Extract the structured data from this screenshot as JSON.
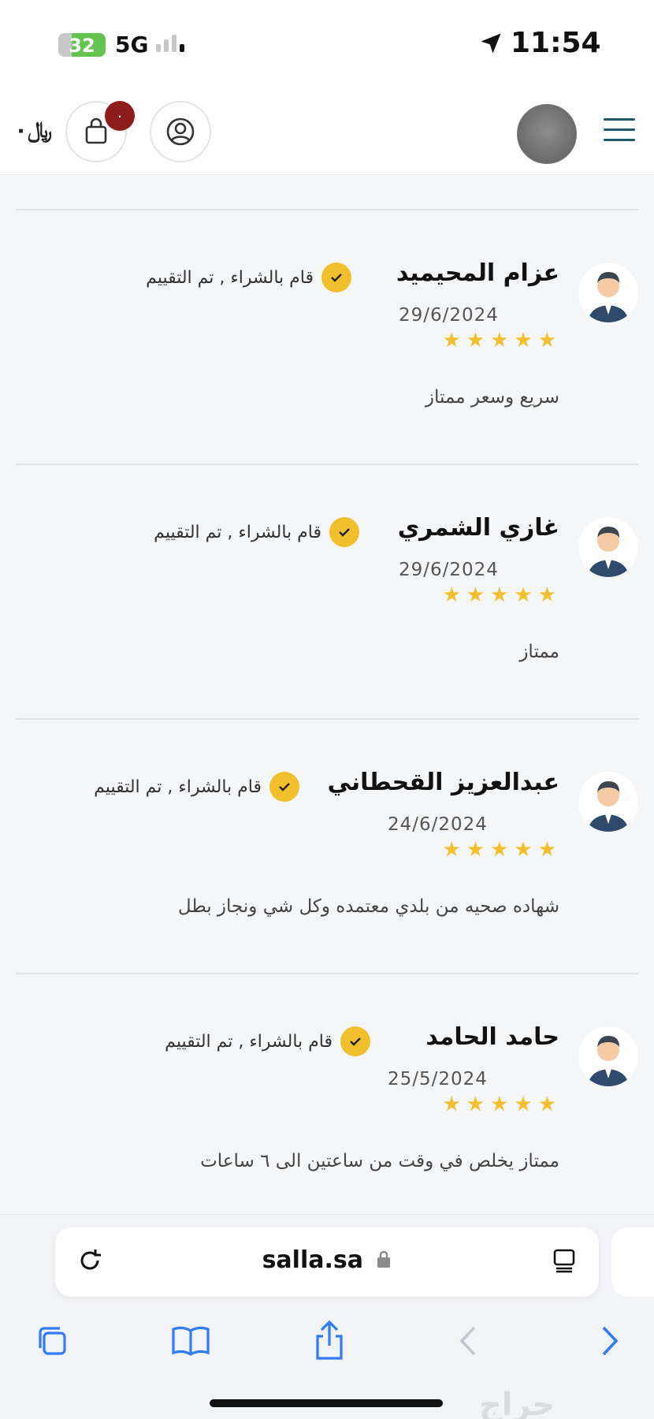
{
  "status_bar": {
    "battery": "32",
    "network": "5G",
    "time": "11:54"
  },
  "header": {
    "currency_symbol": "﷼٠",
    "cart_count": "٠"
  },
  "reviews": [
    {
      "name": "عزام المحيميد",
      "verified": "قام بالشراء , تم التقييم",
      "date": "29/6/2024",
      "rating": 5,
      "comment": "سريع وسعر ممتاز"
    },
    {
      "name": "غازي الشمري",
      "verified": "قام بالشراء , تم التقييم",
      "date": "29/6/2024",
      "rating": 5,
      "comment": "ممتاز"
    },
    {
      "name": "عبدالعزيز القحطاني",
      "verified": "قام بالشراء , تم التقييم",
      "date": "24/6/2024",
      "rating": 5,
      "comment": "شهاده صحيه من بلدي معتمده وكل شي ونجاز بطل"
    },
    {
      "name": "حامد الحامد",
      "verified": "قام بالشراء , تم التقييم",
      "date": "25/5/2024",
      "rating": 5,
      "comment": "ممتاز يخلص في وقت من ساعتين الى ٦ ساعات"
    }
  ],
  "browser": {
    "url": "salla.sa"
  },
  "watermark": "حراج",
  "colors": {
    "star": "#f3bf2c",
    "verified": "#f2bf2c",
    "badge": "#8f1c1c",
    "menu": "#1c5a6a",
    "ios_blue": "#2f7cf6"
  }
}
